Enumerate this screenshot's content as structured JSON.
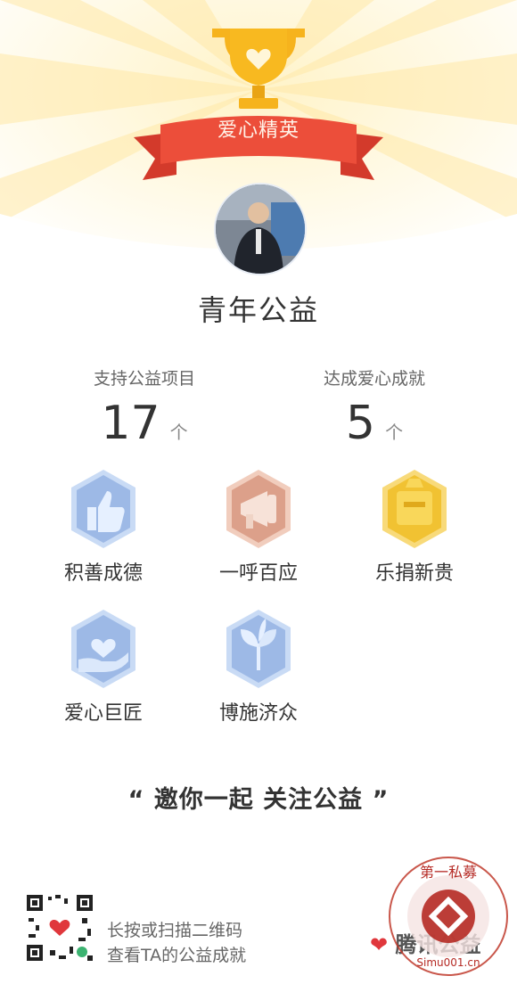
{
  "header": {
    "ribbon_title": "爱心精英"
  },
  "profile": {
    "name": "青年公益"
  },
  "stats": [
    {
      "label": "支持公益项目",
      "value": "17",
      "unit": "个"
    },
    {
      "label": "达成爱心成就",
      "value": "5",
      "unit": "个"
    }
  ],
  "badges": [
    {
      "label": "积善成德",
      "icon": "thumbs-up-icon",
      "color": "#9db9e6"
    },
    {
      "label": "一呼百应",
      "icon": "megaphone-icon",
      "color": "#dca08a"
    },
    {
      "label": "乐捐新贵",
      "icon": "crown-badge-icon",
      "color": "#f1c232"
    },
    {
      "label": "爱心巨匠",
      "icon": "heart-hand-icon",
      "color": "#9db9e6"
    },
    {
      "label": "博施济众",
      "icon": "sprout-icon",
      "color": "#9db9e6"
    }
  ],
  "slogan": "“ 邀你一起 关注公益 ”",
  "footer": {
    "qr_line1": "长按或扫描二维码",
    "qr_line2": "查看TA的公益成就",
    "brand_text": "腾讯公益"
  },
  "watermark": {
    "text": "第一私募",
    "domain": "Simu001.cn"
  }
}
